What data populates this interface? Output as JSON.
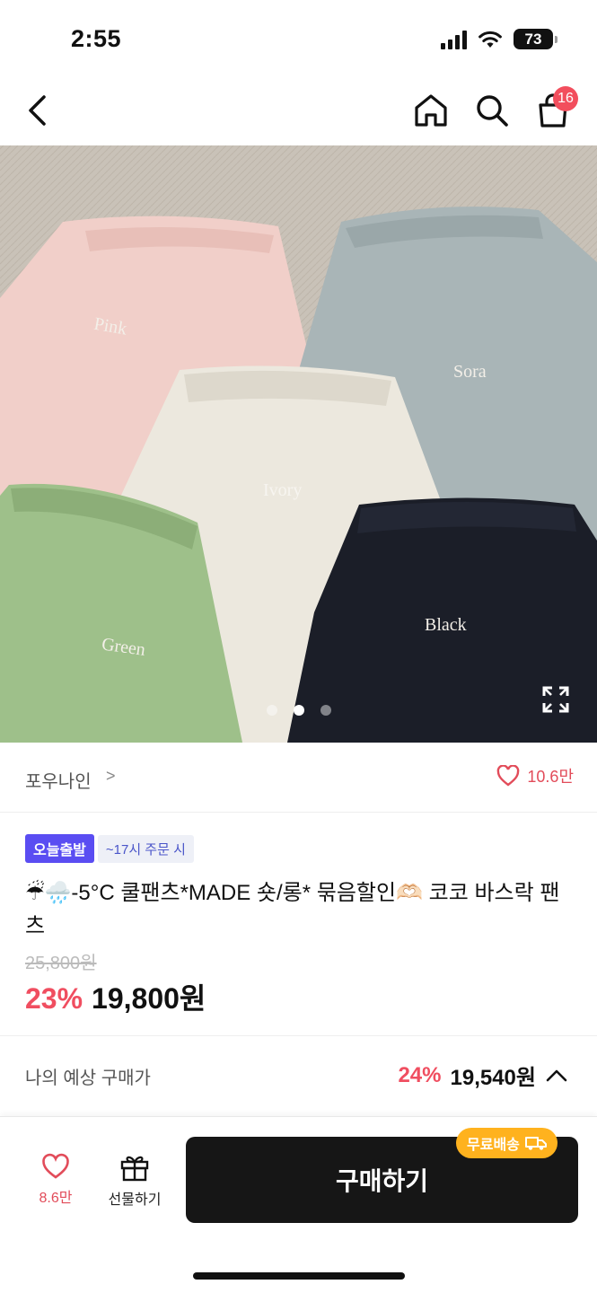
{
  "status_bar": {
    "time": "2:55",
    "battery": "73"
  },
  "nav": {
    "cart_count": "16"
  },
  "hero": {
    "swatches": [
      "Pink",
      "Sora",
      "Ivory",
      "Green",
      "Black"
    ],
    "slide_count": 3,
    "active_slide": 1
  },
  "store": {
    "name": "포우나인",
    "chevron": ">",
    "likes": "10.6만"
  },
  "product": {
    "badge_today": "오늘출발",
    "badge_time": "~17시 주문 시",
    "title": "☔🌧️-5°C 쿨팬츠*MADE 숏/롱* 묶음할인🫶🏻 코코 바스락 팬츠",
    "original_price": "25,800원",
    "discount": "23%",
    "price": "19,800원"
  },
  "expected": {
    "label": "나의 예상 구매가",
    "discount": "24%",
    "price": "19,540원"
  },
  "bottom": {
    "like_count": "8.6만",
    "gift_label": "선물하기",
    "buy_label": "구매하기",
    "free_shipping": "무료배송"
  },
  "colors": {
    "accent_red": "#f04e60",
    "today_badge": "#5a4df2",
    "free_ship": "#ffb21e",
    "buy_button": "#161616"
  }
}
